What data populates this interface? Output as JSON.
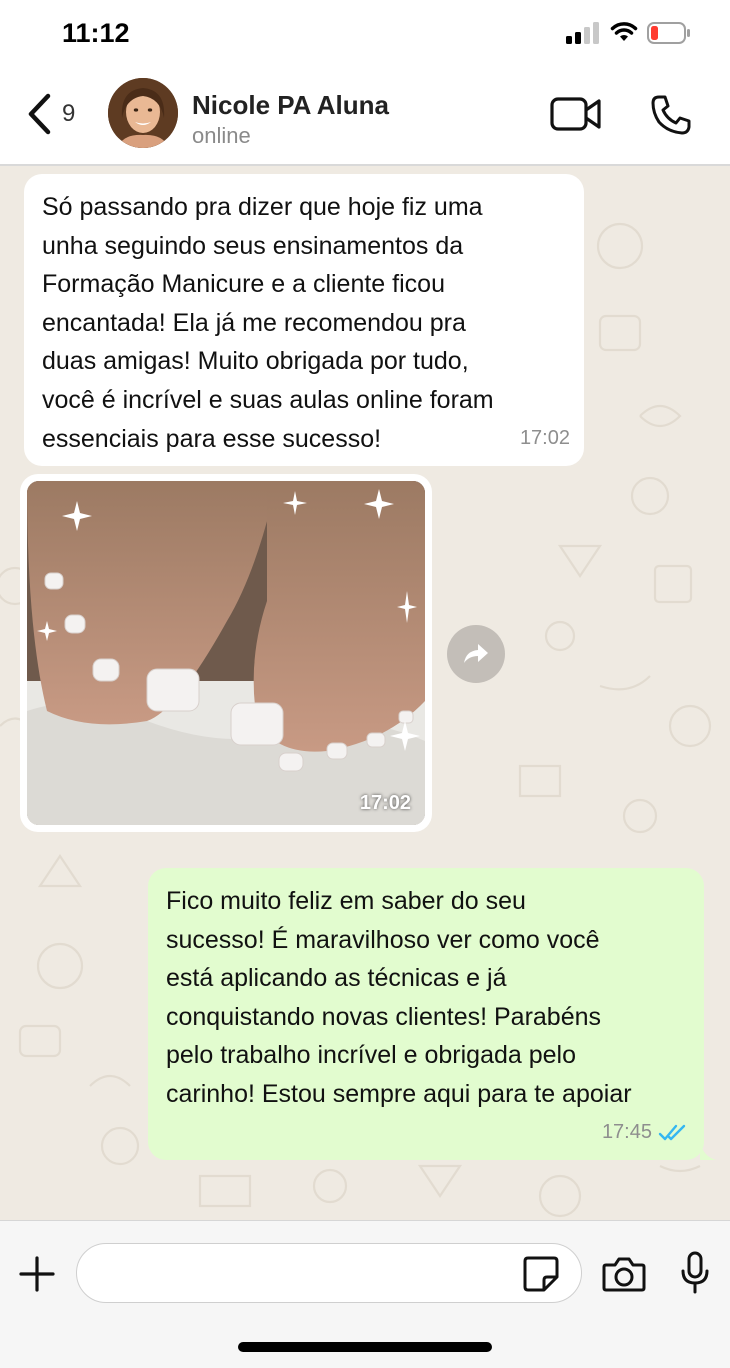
{
  "status_bar": {
    "time": "11:12"
  },
  "header": {
    "back_count": "9",
    "contact_name": "Nicole PA Aluna",
    "contact_status": "online"
  },
  "messages": [
    {
      "direction": "incoming",
      "type": "text",
      "lines": [
        "Só passando pra dizer que hoje fiz uma",
        "unha seguindo seus ensinamentos da",
        "Formação Manicure e a cliente ficou",
        "encantada! Ela já me recomendou pra",
        "duas amigas! Muito obrigada por tudo,",
        "você é incrível e suas aulas online foram",
        "essenciais para esse sucesso!"
      ],
      "time": "17:02"
    },
    {
      "direction": "incoming",
      "type": "image",
      "time": "17:02"
    },
    {
      "direction": "outgoing",
      "type": "text",
      "lines": [
        "Fico muito feliz em saber do seu",
        "sucesso! É maravilhoso ver como você",
        "está aplicando as técnicas e já",
        "conquistando novas clientes! Parabéns",
        "pelo trabalho incrível e obrigada pelo",
        "carinho! Estou sempre aqui para te apoiar"
      ],
      "time": "17:45",
      "read_receipt": "double-check-blue"
    }
  ],
  "input": {
    "placeholder": "",
    "value": ""
  },
  "colors": {
    "chat_background": "#efeae2",
    "incoming_bubble": "#ffffff",
    "outgoing_bubble": "#e2fccf",
    "read_tick": "#34b7f1",
    "battery_low": "#ff3b30"
  }
}
